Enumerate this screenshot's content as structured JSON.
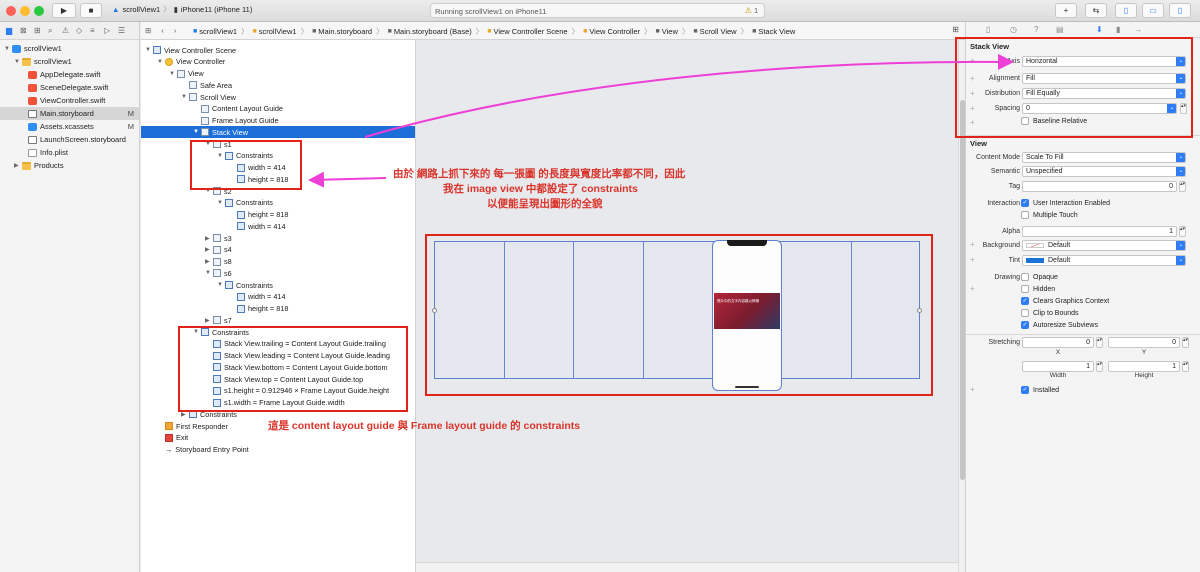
{
  "toolbar": {
    "scheme_project": "scrollView1",
    "scheme_device": "iPhone11 (iPhone 11)",
    "status_text": "Running scrollView1 on iPhone11",
    "warning_count": "1"
  },
  "navigator": {
    "items": [
      {
        "label": "scrollView1",
        "icon": "project-icon",
        "level": 0,
        "marker": ""
      },
      {
        "label": "scrollView1",
        "icon": "folder-icon",
        "level": 1,
        "marker": ""
      },
      {
        "label": "AppDelegate.swift",
        "icon": "swift-icon",
        "level": 2,
        "marker": ""
      },
      {
        "label": "SceneDelegate.swift",
        "icon": "swift-icon",
        "level": 2,
        "marker": ""
      },
      {
        "label": "ViewController.swift",
        "icon": "swift-icon",
        "level": 2,
        "marker": ""
      },
      {
        "label": "Main.storyboard",
        "icon": "storyboard-icon",
        "level": 2,
        "marker": "M"
      },
      {
        "label": "Assets.xcassets",
        "icon": "assets-icon",
        "level": 2,
        "marker": "M"
      },
      {
        "label": "LaunchScreen.storyboard",
        "icon": "storyboard-icon",
        "level": 2,
        "marker": ""
      },
      {
        "label": "Info.plist",
        "icon": "plist-icon",
        "level": 2,
        "marker": ""
      },
      {
        "label": "Products",
        "icon": "folder-icon",
        "level": 1,
        "marker": ""
      }
    ]
  },
  "jumpbar": [
    "scrollView1",
    "scrollView1",
    "Main.storyboard",
    "Main.storyboard (Base)",
    "View Controller Scene",
    "View Controller",
    "View",
    "Scroll View",
    "Stack View"
  ],
  "outline": {
    "rows": [
      "View Controller Scene",
      "View Controller",
      "View",
      "Safe Area",
      "Scroll View",
      "Content Layout Guide",
      "Frame Layout Guide",
      "Stack View",
      "s1",
      "Constraints",
      "width = 414",
      "height = 818",
      "s2",
      "Constraints",
      "height = 818",
      "width = 414",
      "s3",
      "s4",
      "s8",
      "s6",
      "Constraints",
      "width = 414",
      "height = 818",
      "s7",
      "Constraints",
      "Stack View.trailing = Content Layout Guide.trailing",
      "Stack View.leading = Content Layout Guide.leading",
      "Stack View.bottom = Content Layout Guide.bottom",
      "Stack View.top = Content Layout Guide.top",
      "s1.height = 0.912946 × Frame Layout Guide.height",
      "s1.width = Frame Layout Guide.width",
      "Constraints",
      "First Responder",
      "Exit",
      "Storyboard Entry Point"
    ]
  },
  "annotations": {
    "note1_line1": "由於 網路上抓下來的 每一張圖 的長度與寬度比率都不同，因此",
    "note1_line2": "我在 image view 中都設定了 constraints",
    "note1_line3": "以便能呈現出圖形的全貌",
    "note2": "這是 content layout guide 與 Frame layout guide 的  constraints"
  },
  "phone_image_text": "照片中的文字內容難以辨識",
  "inspector": {
    "stack_title": "Stack View",
    "axis_label": "Axis",
    "axis_value": "Horizontal",
    "alignment_label": "Alignment",
    "alignment_value": "Fill",
    "distribution_label": "Distribution",
    "distribution_value": "Fill Equally",
    "spacing_label": "Spacing",
    "spacing_value": "0",
    "baseline_label": "Baseline Relative",
    "view_title": "View",
    "content_mode_label": "Content Mode",
    "content_mode_value": "Scale To Fill",
    "semantic_label": "Semantic",
    "semantic_value": "Unspecified",
    "tag_label": "Tag",
    "tag_value": "0",
    "interaction_label": "Interaction",
    "user_interaction": "User Interaction Enabled",
    "multiple_touch": "Multiple Touch",
    "alpha_label": "Alpha",
    "alpha_value": "1",
    "background_label": "Background",
    "background_value": "Default",
    "tint_label": "Tint",
    "tint_value": "Default",
    "drawing_label": "Drawing",
    "opaque": "Opaque",
    "hidden": "Hidden",
    "clears": "Clears Graphics Context",
    "clip": "Clip to Bounds",
    "autoresize": "Autoresize Subviews",
    "stretching_label": "Stretching",
    "stretch_x": "0",
    "stretch_y": "0",
    "stretch_w": "1",
    "stretch_h": "1",
    "x_label": "X",
    "y_label": "Y",
    "width_label": "Width",
    "height_label": "Height",
    "installed": "Installed"
  },
  "colors": {
    "accent": "#1c6fd8",
    "annotation": "#e02418",
    "arrow": "#ee3fd6",
    "tint": "#2e7cf6"
  }
}
